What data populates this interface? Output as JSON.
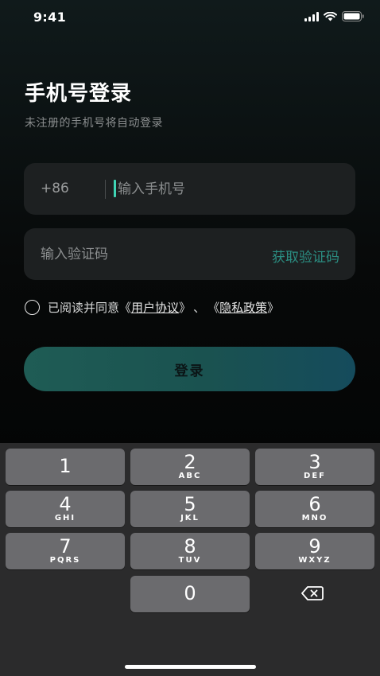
{
  "status_bar": {
    "time": "9:41"
  },
  "login": {
    "title": "手机号登录",
    "subtitle": "未注册的手机号将自动登录",
    "country_code": "+86",
    "phone_placeholder": "输入手机号",
    "code_placeholder": "输入验证码",
    "get_code_label": "获取验证码",
    "agreement_prefix": "已阅读并同意",
    "user_agreement_open": "《",
    "user_agreement_label": "用户协议",
    "user_agreement_close": "》",
    "separator": "、",
    "privacy_open": "《",
    "privacy_label": "隐私政策",
    "privacy_close": "》",
    "login_label": "登录",
    "accent_color": "#2b8e82",
    "caret_color": "#3fd4b4"
  },
  "keyboard": {
    "keys": [
      {
        "digit": "1",
        "letters": ""
      },
      {
        "digit": "2",
        "letters": "ABC"
      },
      {
        "digit": "3",
        "letters": "DEF"
      },
      {
        "digit": "4",
        "letters": "GHI"
      },
      {
        "digit": "5",
        "letters": "JKL"
      },
      {
        "digit": "6",
        "letters": "MNO"
      },
      {
        "digit": "7",
        "letters": "PQRS"
      },
      {
        "digit": "8",
        "letters": "TUV"
      },
      {
        "digit": "9",
        "letters": "WXYZ"
      },
      {
        "digit": "0",
        "letters": ""
      }
    ],
    "delete_icon": "backspace-icon"
  }
}
